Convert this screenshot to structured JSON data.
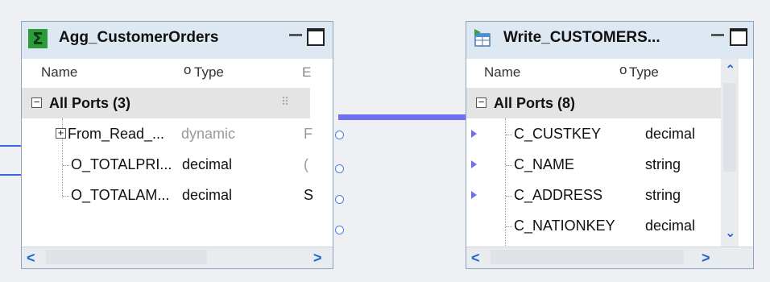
{
  "agg": {
    "title": "Agg_CustomerOrders",
    "col_name": "Name",
    "col_type": "Type",
    "col_third": "E",
    "group_label": "All Ports (3)",
    "rows": [
      {
        "name": "From_Read_...",
        "type": "dynamic",
        "extra": "F"
      },
      {
        "name": "O_TOTALPRI...",
        "type": "decimal",
        "extra": "("
      },
      {
        "name": "O_TOTALAM...",
        "type": "decimal",
        "extra": "S"
      }
    ]
  },
  "write": {
    "title": "Write_CUSTOMERS...",
    "col_name": "Name",
    "col_type": "Type",
    "group_label": "All Ports (8)",
    "rows": [
      {
        "name": "C_CUSTKEY",
        "type": "decimal"
      },
      {
        "name": "C_NAME",
        "type": "string"
      },
      {
        "name": "C_ADDRESS",
        "type": "string"
      },
      {
        "name": "C_NATIONKEY",
        "type": "decimal"
      }
    ]
  },
  "colors": {
    "link": "#6f6ff2",
    "panel_border": "#8aa4bf",
    "header_bg": "#dde8f3",
    "group_row_bg": "#e4e4e4",
    "arrow": "#1f63d2"
  },
  "icons": {
    "agg_title_icon": "sigma-icon",
    "write_title_icon": "table-write-icon"
  }
}
